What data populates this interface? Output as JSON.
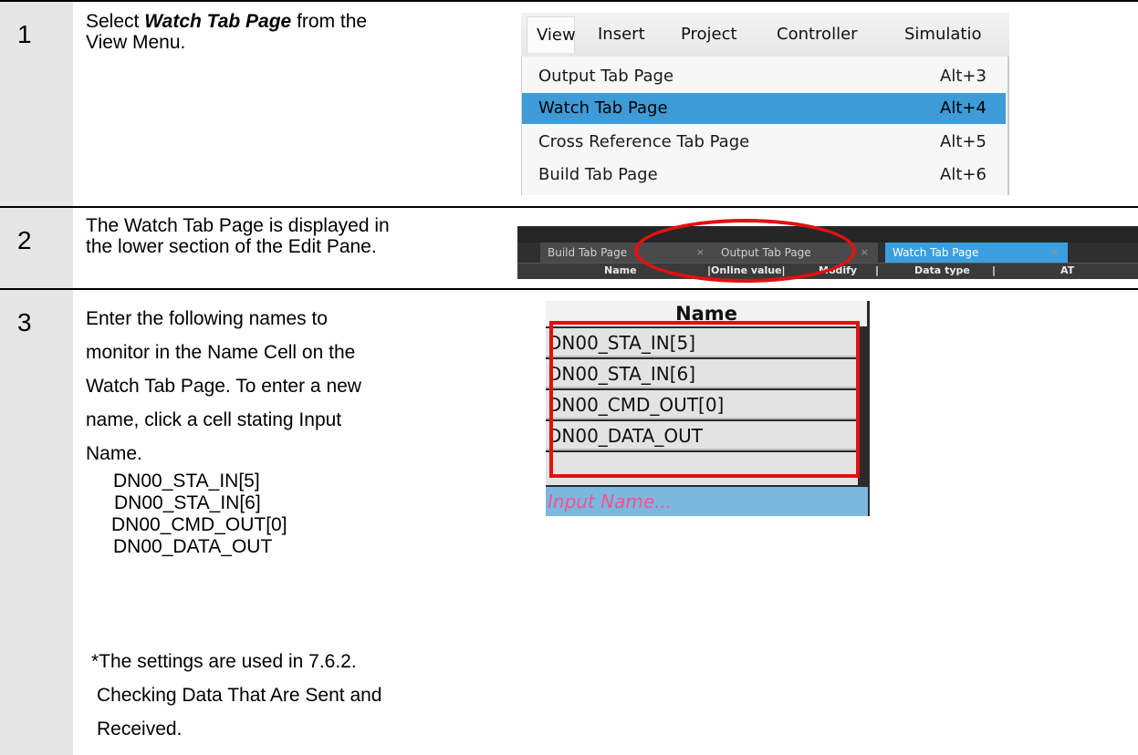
{
  "steps": [
    {
      "number": "1",
      "text_bold": "Watch Tab Page",
      "text_pre": "Select ",
      "text_post": " from the",
      "text_line2": "View Menu."
    },
    {
      "number": "2",
      "text_line1": "The Watch Tab Page is displayed in",
      "text_line2": "the lower section of the Edit Pane."
    },
    {
      "number": "3",
      "text_lines": [
        "Enter the following names to",
        "monitor in the Name Cell on the",
        "Watch Tab Page. To enter a new",
        "name, click a cell stating Input",
        "Name."
      ],
      "names": [
        "DN00_STA_IN[5]",
        "DN00_STA_IN[6]",
        "DN00_CMD_OUT[0]",
        "DN00_DATA_OUT"
      ],
      "note_lines": [
        "*The settings are used in 7.6.2.",
        "Checking Data That Are Sent and",
        "Received."
      ]
    }
  ],
  "menu": {
    "bar": [
      "View",
      "Insert",
      "Project",
      "Controller",
      "Simulatio"
    ],
    "items": [
      {
        "label": "Output Tab Page",
        "shortcut": "Alt+3"
      },
      {
        "label": "Watch Tab Page",
        "shortcut": "Alt+4"
      },
      {
        "label": "Cross Reference Tab Page",
        "shortcut": "Alt+5"
      },
      {
        "label": "Build Tab Page",
        "shortcut": "Alt+6"
      }
    ],
    "selected_index": 1,
    "selected_color": "#3d9bd7"
  },
  "tabs": {
    "items": [
      {
        "label": "Build Tab Page",
        "close": "×"
      },
      {
        "label": "Output Tab Page",
        "close": "×"
      },
      {
        "label": "Watch Tab Page",
        "close": "×"
      }
    ],
    "active_index": 2,
    "columns": [
      "Name",
      "|Online value|",
      "Modify",
      "|",
      "Data type",
      "|",
      "AT"
    ]
  },
  "watch_table": {
    "header": "Name",
    "rows": [
      "DN00_STA_IN[5]",
      "DN00_STA_IN[6]",
      "DN00_CMD_OUT[0]",
      "DN00_DATA_OUT"
    ],
    "input_placeholder": "Input Name..."
  },
  "colors": {
    "highlight_red": "#e41010",
    "step_column": "#e6e6e6",
    "active_tab": "#3a9fe0"
  }
}
